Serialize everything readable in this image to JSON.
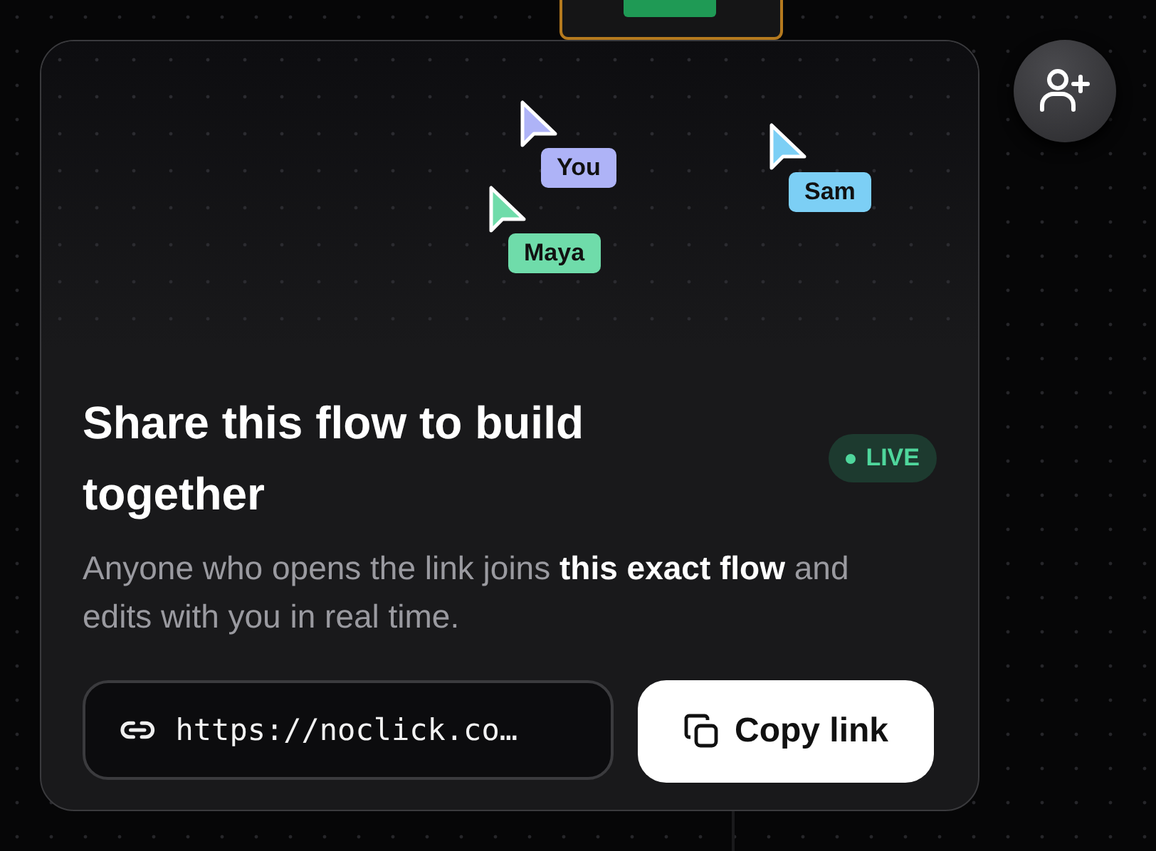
{
  "cursors": [
    {
      "name": "You",
      "color": "#aeb3f7"
    },
    {
      "name": "Maya",
      "color": "#6fdcaa"
    },
    {
      "name": "Sam",
      "color": "#7ccff5"
    }
  ],
  "title": "Share this flow to build together",
  "badge": {
    "label": "LIVE",
    "live": true
  },
  "description": "Anyone who opens the link joins **this exact flow** and edits with you in real time.",
  "link": {
    "value": "https://noclick.co…"
  },
  "copy_button": {
    "label": "Copy link"
  }
}
